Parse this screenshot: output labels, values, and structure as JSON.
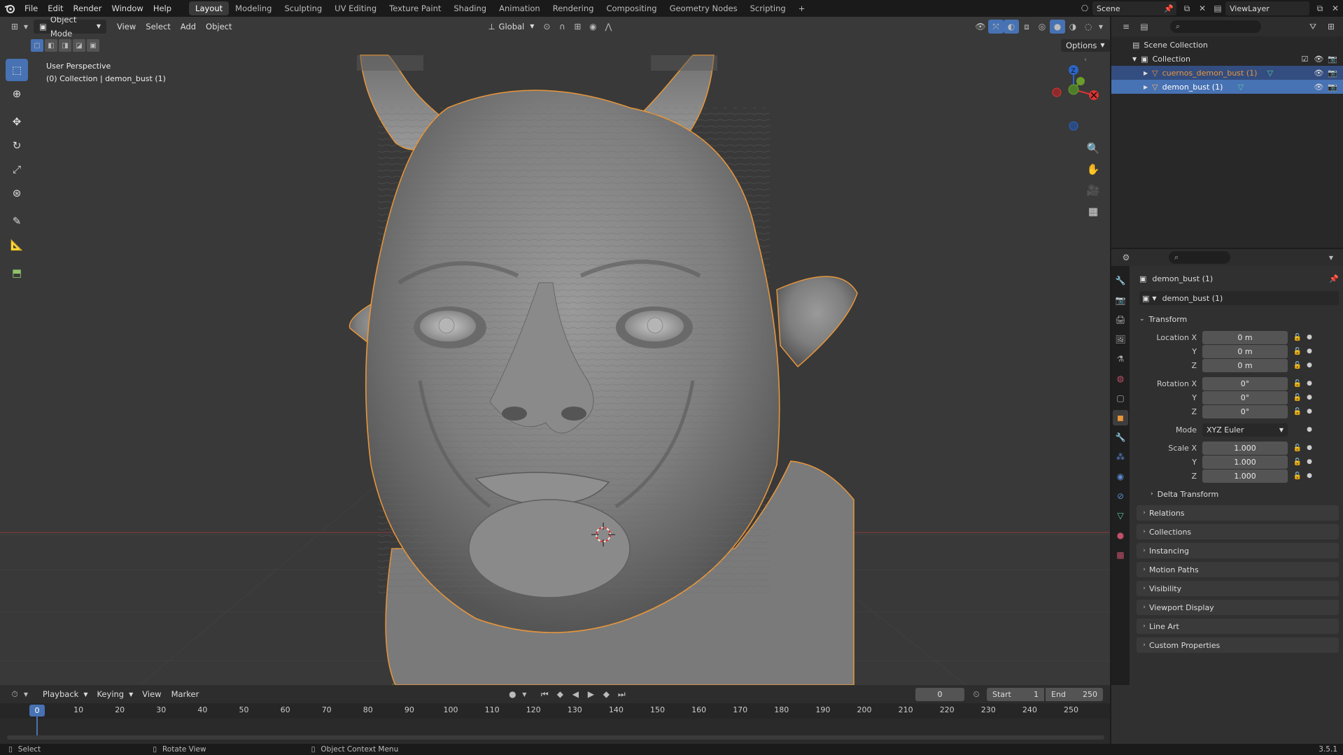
{
  "topbar": {
    "menus": [
      "File",
      "Edit",
      "Render",
      "Window",
      "Help"
    ],
    "workspaces": [
      "Layout",
      "Modeling",
      "Sculpting",
      "UV Editing",
      "Texture Paint",
      "Shading",
      "Animation",
      "Rendering",
      "Compositing",
      "Geometry Nodes",
      "Scripting"
    ],
    "active_workspace": "Layout",
    "add_tab": "+",
    "scene": "Scene",
    "view_layer": "ViewLayer"
  },
  "viewport": {
    "mode": "Object Mode",
    "menus": [
      "View",
      "Select",
      "Add",
      "Object"
    ],
    "orientation": "Global",
    "options_label": "Options",
    "overlay_line1": "User Perspective",
    "overlay_line2": "(0) Collection | demon_bust (1)",
    "gizmo_z": "Z"
  },
  "outliner": {
    "scene_collection": "Scene Collection",
    "collection": "Collection",
    "items": [
      {
        "name": "cuernos_demon_bust (1)"
      },
      {
        "name": "demon_bust (1)"
      }
    ]
  },
  "properties": {
    "object_name": "demon_bust (1)",
    "datablock_name": "demon_bust (1)",
    "transform_title": "Transform",
    "location": {
      "label": "Location X",
      "x": "0 m",
      "y": "0 m",
      "z": "0 m"
    },
    "rotation": {
      "label": "Rotation X",
      "x": "0°",
      "y": "0°",
      "z": "0°"
    },
    "mode_label": "Mode",
    "mode_value": "XYZ Euler",
    "scale": {
      "label": "Scale X",
      "x": "1.000",
      "y": "1.000",
      "z": "1.000"
    },
    "axis_y": "Y",
    "axis_z": "Z",
    "delta_transform": "Delta Transform",
    "panels": [
      "Relations",
      "Collections",
      "Instancing",
      "Motion Paths",
      "Visibility",
      "Viewport Display",
      "Line Art",
      "Custom Properties"
    ]
  },
  "timeline": {
    "menus": [
      "Playback",
      "Keying",
      "View",
      "Marker"
    ],
    "current_frame": "0",
    "start_label": "Start",
    "start_value": "1",
    "end_label": "End",
    "end_value": "250",
    "ticks": [
      "0",
      "10",
      "20",
      "30",
      "40",
      "50",
      "60",
      "70",
      "80",
      "90",
      "100",
      "110",
      "120",
      "130",
      "140",
      "150",
      "160",
      "170",
      "180",
      "190",
      "200",
      "210",
      "220",
      "230",
      "240",
      "250"
    ],
    "playhead": "0"
  },
  "statusbar": {
    "select": "Select",
    "rotate_view": "Rotate View",
    "context_menu": "Object Context Menu",
    "version": "3.5.1"
  },
  "colors": {
    "accent": "#4772b3",
    "selection_outline": "#e8963a",
    "viewport_bg": "#393939"
  }
}
